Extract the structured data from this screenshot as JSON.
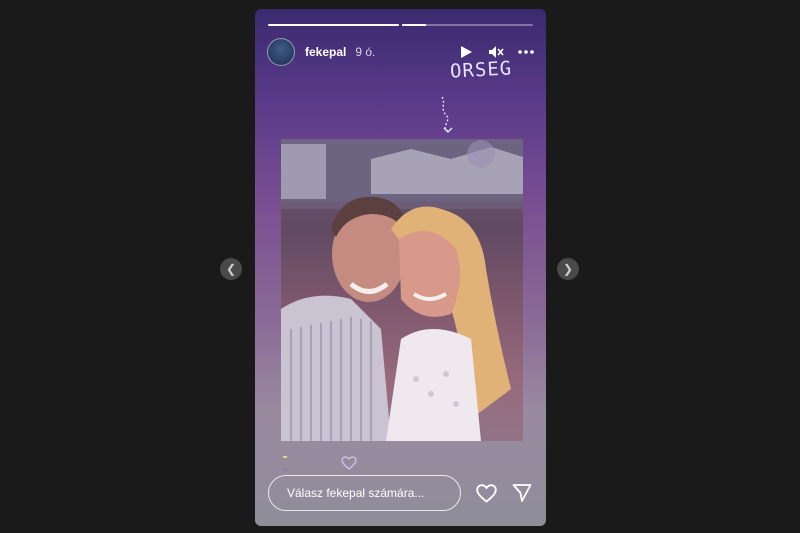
{
  "story": {
    "username": "fekepal",
    "time": "9 ó.",
    "progress": [
      1.0,
      0.18
    ],
    "sticker_text": "ORSEG",
    "reply_placeholder": "Válasz fekepal számára...",
    "colors": {
      "accent": "#ffffff",
      "background": "#1a1a1a"
    },
    "icons": [
      "play-icon",
      "mute-icon",
      "more-icon",
      "heart-icon",
      "send-icon",
      "chevron-left-icon",
      "chevron-right-icon"
    ]
  }
}
